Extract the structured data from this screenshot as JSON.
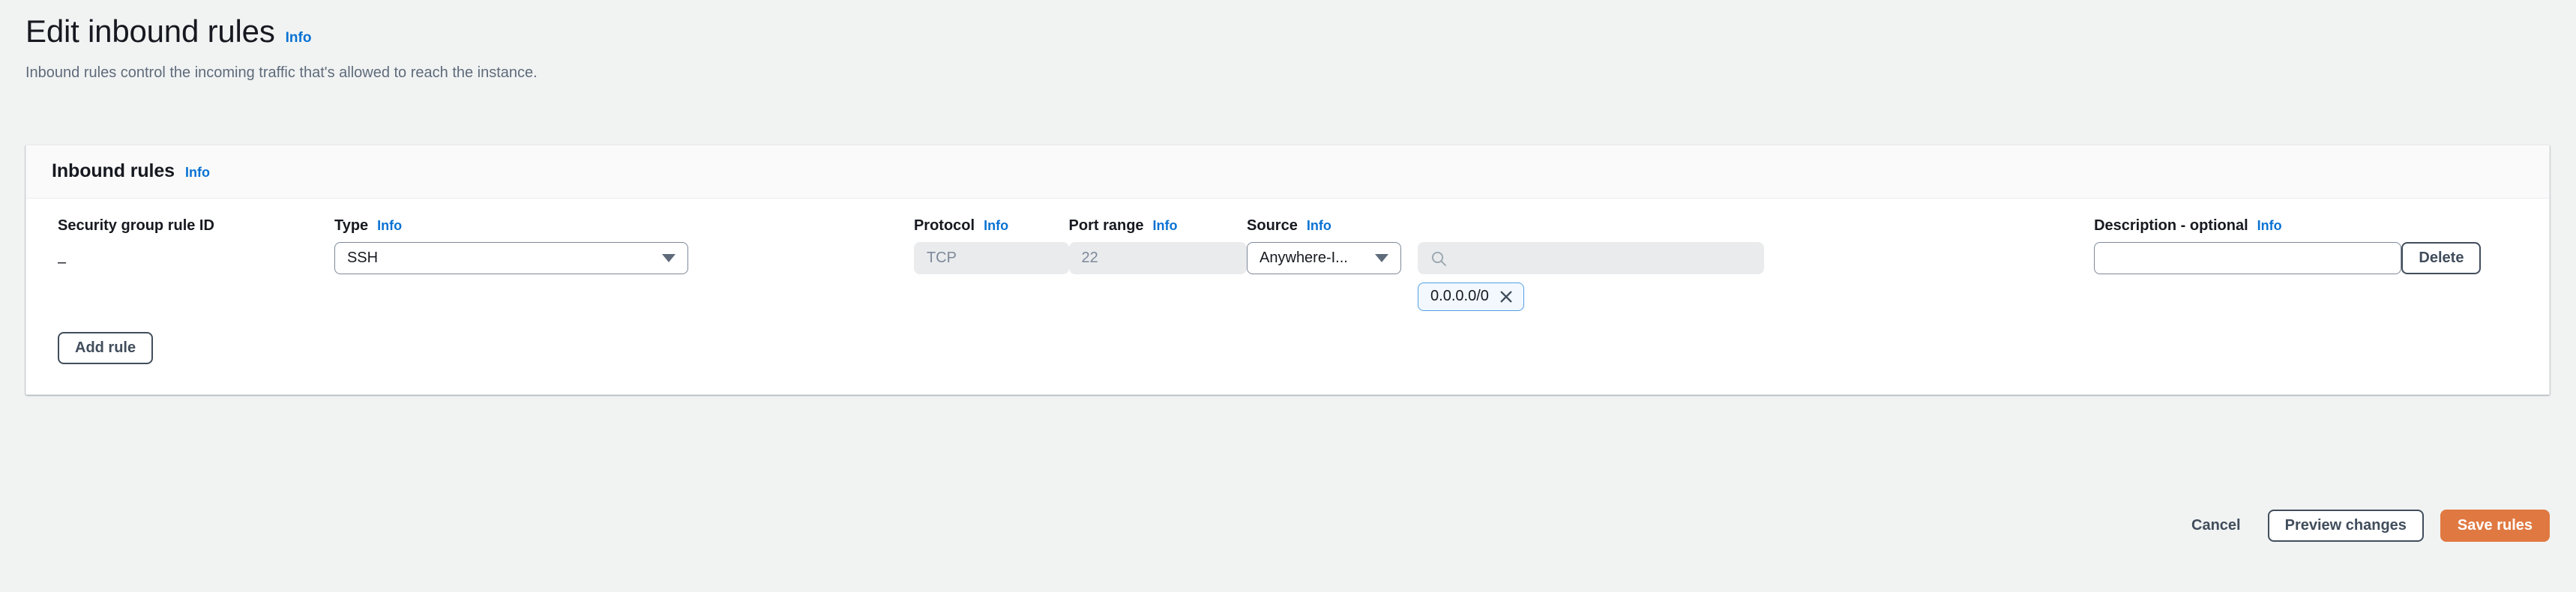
{
  "header": {
    "title": "Edit inbound rules",
    "info_label": "Info",
    "description": "Inbound rules control the incoming traffic that's allowed to reach the instance."
  },
  "panel": {
    "title": "Inbound rules",
    "info_label": "Info"
  },
  "table": {
    "columns": [
      {
        "label": "Security group rule ID",
        "info": ""
      },
      {
        "label": "Type",
        "info": "Info"
      },
      {
        "label": "Protocol",
        "info": "Info"
      },
      {
        "label": "Port range",
        "info": "Info"
      },
      {
        "label": "Source",
        "info": "Info"
      },
      {
        "label": "Description - optional",
        "info": "Info"
      }
    ],
    "rows": [
      {
        "security_group_rule_id": "–",
        "type": "SSH",
        "protocol": "TCP",
        "port_range": "22",
        "source_type": "Anywhere-I...",
        "source_search_placeholder": "",
        "source_tokens": [
          "0.0.0.0/0"
        ],
        "description": "",
        "description_placeholder": "",
        "delete_label": "Delete"
      }
    ]
  },
  "actions": {
    "add_rule": "Add rule",
    "cancel": "Cancel",
    "preview_changes": "Preview changes",
    "save_rules": "Save rules"
  },
  "colors": {
    "page_background": "#f1f3f3",
    "panel_background": "#ffffff",
    "panel_header_background": "#fafafa",
    "link_blue": "#0972d3",
    "primary_orange": "#e07941",
    "text_dark": "#16191f",
    "text_muted": "#5f6b7a",
    "disabled_field": "#e9ebed",
    "token_background": "#f2f8fd",
    "token_border": "#539fe5"
  },
  "icons": {
    "search": "search-icon",
    "chevron_down": "chevron-down-icon",
    "token_dismiss": "close-icon"
  }
}
